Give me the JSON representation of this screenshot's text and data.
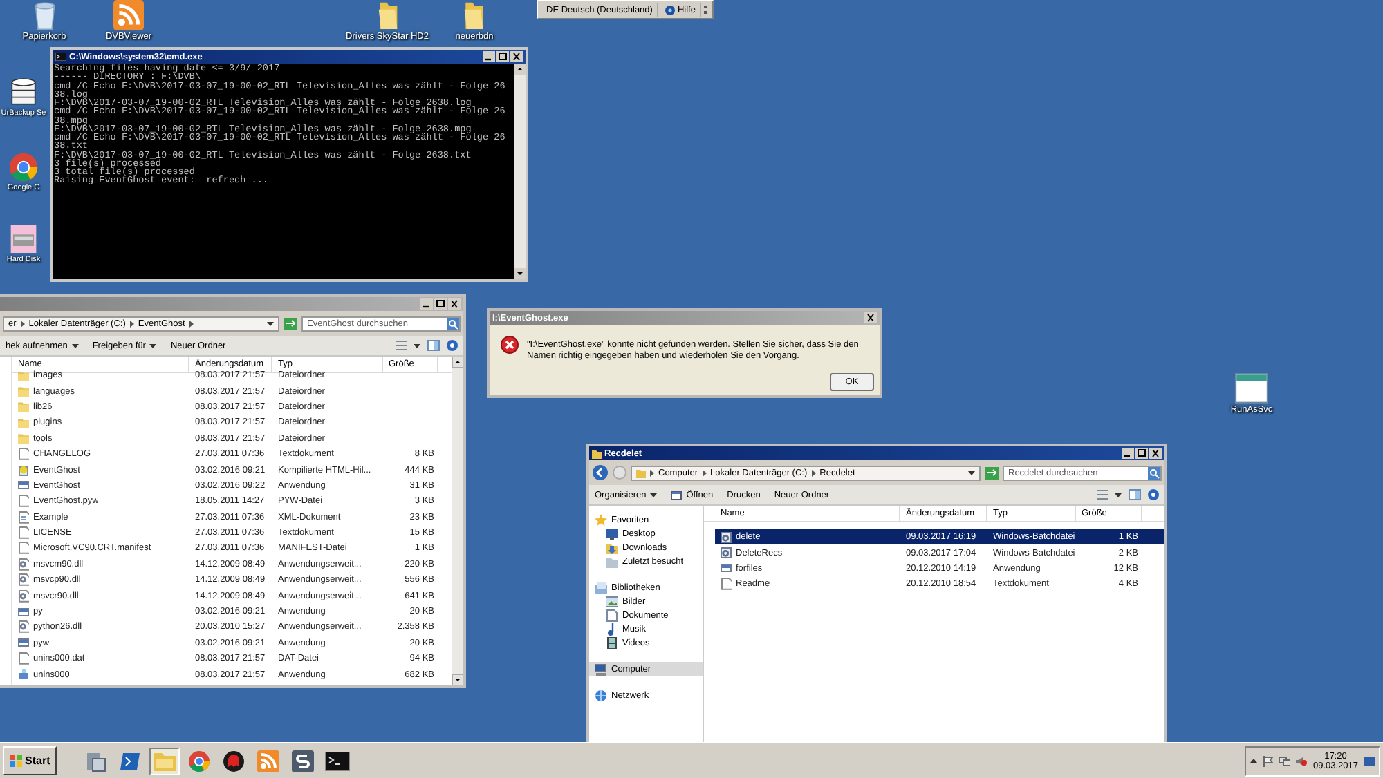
{
  "language_bar": {
    "language": "DE Deutsch (Deutschland)",
    "help": "Hilfe"
  },
  "desktop_icons": [
    {
      "label": "Papierkorb",
      "kind": "recycle"
    },
    {
      "label": "DVBViewer",
      "kind": "feed"
    },
    {
      "label": "Drivers SkyStar HD2",
      "kind": "folder"
    },
    {
      "label": "neuerbdn",
      "kind": "folder"
    },
    {
      "label": "UrBackup Se",
      "kind": "database"
    },
    {
      "label": "Google C",
      "kind": "chrome"
    },
    {
      "label": "Hard Disk",
      "kind": "disk"
    },
    {
      "label": "RunAsSvc",
      "kind": "window"
    }
  ],
  "cmd_window": {
    "title": "C:\\Windows\\system32\\cmd.exe",
    "active": true,
    "lines": [
      "Searching files having date <= 3/9/ 2017",
      "------ DIRECTORY : F:\\DVB\\",
      "cmd /C Echo F:\\DVB\\2017-03-07_19-00-02_RTL Television_Alles was zählt - Folge 26",
      "38.log",
      "F:\\DVB\\2017-03-07_19-00-02_RTL Television_Alles was zählt - Folge 2638.log",
      "cmd /C Echo F:\\DVB\\2017-03-07_19-00-02_RTL Television_Alles was zählt - Folge 26",
      "38.mpg",
      "F:\\DVB\\2017-03-07_19-00-02_RTL Television_Alles was zählt - Folge 2638.mpg",
      "cmd /C Echo F:\\DVB\\2017-03-07_19-00-02_RTL Television_Alles was zählt - Folge 26",
      "38.txt",
      "F:\\DVB\\2017-03-07_19-00-02_RTL Television_Alles was zählt - Folge 2638.txt",
      "3 file(s) processed",
      "3 total file(s) processed",
      "Raising EventGhost event:  refrech ..."
    ]
  },
  "explorer_left": {
    "active": false,
    "breadcrumb": [
      "er",
      "Lokaler Datenträger (C:)",
      "EventGhost"
    ],
    "search_placeholder": "EventGhost durchsuchen",
    "toolbar": [
      {
        "label": "hek aufnehmen",
        "dropdown": true
      },
      {
        "label": "Freigeben für",
        "dropdown": true
      },
      {
        "label": "Neuer Ordner",
        "dropdown": false
      }
    ],
    "columns": [
      "Name",
      "Änderungsdatum",
      "Typ",
      "Größe"
    ],
    "rows": [
      {
        "name": "images",
        "date": "08.03.2017 21:57",
        "type": "Dateiordner",
        "size": "",
        "kind": "folder",
        "selected": false
      },
      {
        "name": "languages",
        "date": "08.03.2017 21:57",
        "type": "Dateiordner",
        "kind": "folder",
        "selected": false
      },
      {
        "name": "lib26",
        "date": "08.03.2017 21:57",
        "type": "Dateiordner",
        "kind": "folder",
        "selected": false
      },
      {
        "name": "plugins",
        "date": "08.03.2017 21:57",
        "type": "Dateiordner",
        "kind": "folder",
        "selected": false
      },
      {
        "name": "tools",
        "date": "08.03.2017 21:57",
        "type": "Dateiordner",
        "kind": "folder",
        "selected": false
      },
      {
        "name": "CHANGELOG",
        "date": "27.03.2011 07:36",
        "type": "Textdokument",
        "size": "8 KB",
        "kind": "text",
        "selected": false
      },
      {
        "name": "EventGhost",
        "date": "03.02.2016 09:21",
        "type": "Kompilierte HTML-Hil...",
        "size": "444 KB",
        "kind": "help",
        "selected": false
      },
      {
        "name": "EventGhost",
        "date": "03.02.2016 09:22",
        "type": "Anwendung",
        "size": "31 KB",
        "kind": "app",
        "selected": false
      },
      {
        "name": "EventGhost.pyw",
        "date": "18.05.2011 14:27",
        "type": "PYW-Datei",
        "size": "3 KB",
        "kind": "text",
        "selected": false
      },
      {
        "name": "Example",
        "date": "27.03.2011 07:36",
        "type": "XML-Dokument",
        "size": "23 KB",
        "kind": "xml",
        "selected": false
      },
      {
        "name": "LICENSE",
        "date": "27.03.2011 07:36",
        "type": "Textdokument",
        "size": "15 KB",
        "kind": "text",
        "selected": false
      },
      {
        "name": "Microsoft.VC90.CRT.manifest",
        "date": "27.03.2011 07:36",
        "type": "MANIFEST-Datei",
        "size": "1 KB",
        "kind": "text",
        "selected": false
      },
      {
        "name": "msvcm90.dll",
        "date": "14.12.2009 08:49",
        "type": "Anwendungserweit...",
        "size": "220 KB",
        "kind": "dll",
        "selected": false
      },
      {
        "name": "msvcp90.dll",
        "date": "14.12.2009 08:49",
        "type": "Anwendungserweit...",
        "size": "556 KB",
        "kind": "dll",
        "selected": false
      },
      {
        "name": "msvcr90.dll",
        "date": "14.12.2009 08:49",
        "type": "Anwendungserweit...",
        "size": "641 KB",
        "kind": "dll",
        "selected": false
      },
      {
        "name": "py",
        "date": "03.02.2016 09:21",
        "type": "Anwendung",
        "size": "20 KB",
        "kind": "app",
        "selected": false
      },
      {
        "name": "python26.dll",
        "date": "20.03.2010 15:27",
        "type": "Anwendungserweit...",
        "size": "2.358 KB",
        "kind": "dll",
        "selected": false
      },
      {
        "name": "pyw",
        "date": "03.02.2016 09:21",
        "type": "Anwendung",
        "size": "20 KB",
        "kind": "app",
        "selected": false
      },
      {
        "name": "unins000.dat",
        "date": "08.03.2017 21:57",
        "type": "DAT-Datei",
        "size": "94 KB",
        "kind": "text",
        "selected": false
      },
      {
        "name": "unins000",
        "date": "08.03.2017 21:57",
        "type": "Anwendung",
        "size": "682 KB",
        "kind": "installer",
        "selected": false
      }
    ]
  },
  "error_dialog": {
    "title": "I:\\EventGhost.exe",
    "message": "\"I:\\EventGhost.exe\" konnte nicht gefunden werden. Stellen Sie sicher, dass Sie den Namen richtig eingegeben haben und wiederholen Sie den Vorgang.",
    "button": "OK"
  },
  "explorer_right": {
    "title": "Recdelet",
    "active": true,
    "breadcrumb": [
      "Computer",
      "Lokaler Datenträger (C:)",
      "Recdelet"
    ],
    "search_placeholder": "Recdelet durchsuchen",
    "toolbar": [
      {
        "label": "Organisieren",
        "dropdown": true
      },
      {
        "label": "Öffnen",
        "dropdown": false,
        "kind": "open"
      },
      {
        "label": "Drucken",
        "dropdown": false
      },
      {
        "label": "Neuer Ordner",
        "dropdown": false
      }
    ],
    "nav": [
      {
        "label": "Favoriten",
        "kind": "star",
        "selected": false,
        "children": [
          {
            "label": "Desktop",
            "kind": "desktop",
            "selected": false
          },
          {
            "label": "Downloads",
            "kind": "downloads",
            "selected": false
          },
          {
            "label": "Zuletzt besucht",
            "kind": "recent",
            "selected": false
          }
        ]
      },
      {
        "label": "Bibliotheken",
        "kind": "library",
        "selected": false,
        "children": [
          {
            "label": "Bilder",
            "kind": "pictures",
            "selected": false
          },
          {
            "label": "Dokumente",
            "kind": "documents",
            "selected": false
          },
          {
            "label": "Musik",
            "kind": "music",
            "selected": false
          },
          {
            "label": "Videos",
            "kind": "videos",
            "selected": false
          }
        ]
      },
      {
        "label": "Computer",
        "kind": "computer",
        "selected": true
      },
      {
        "label": "Netzwerk",
        "kind": "network",
        "selected": false
      }
    ],
    "columns": [
      "Name",
      "Änderungsdatum",
      "Typ",
      "Größe"
    ],
    "rows": [
      {
        "name": "delete",
        "date": "09.03.2017 16:19",
        "type": "Windows-Batchdatei",
        "size": "1 KB",
        "kind": "bat",
        "selected": true
      },
      {
        "name": "DeleteRecs",
        "date": "09.03.2017 17:04",
        "type": "Windows-Batchdatei",
        "size": "2 KB",
        "kind": "bat",
        "selected": false
      },
      {
        "name": "forfiles",
        "date": "20.12.2010 14:19",
        "type": "Anwendung",
        "size": "12 KB",
        "kind": "app",
        "selected": false
      },
      {
        "name": "Readme",
        "date": "20.12.2010 18:54",
        "type": "Textdokument",
        "size": "4 KB",
        "kind": "text",
        "selected": false
      }
    ]
  },
  "taskbar": {
    "start": "Start",
    "apps": [
      {
        "kind": "server",
        "active": false
      },
      {
        "kind": "powershell",
        "active": false
      },
      {
        "kind": "explorer",
        "active": true
      },
      {
        "kind": "chrome",
        "active": false
      },
      {
        "kind": "ghost",
        "active": false
      },
      {
        "kind": "feed",
        "active": false
      },
      {
        "kind": "s",
        "active": false
      },
      {
        "kind": "console",
        "active": false
      }
    ],
    "time": "17:20",
    "date": "09.03.2017"
  }
}
